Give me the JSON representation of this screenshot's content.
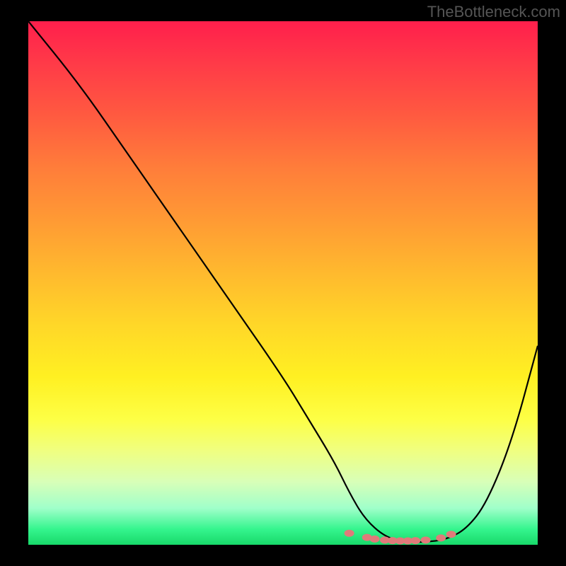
{
  "watermark": "TheBottleneck.com",
  "chart_data": {
    "type": "line",
    "title": "",
    "xlabel": "",
    "ylabel": "",
    "xlim": [
      0,
      100
    ],
    "ylim": [
      0,
      100
    ],
    "series": [
      {
        "name": "bottleneck-curve",
        "color": "#000000",
        "x": [
          0,
          10,
          20,
          30,
          40,
          50,
          55,
          60,
          63,
          66,
          70,
          74,
          78,
          82,
          86,
          90,
          95,
          100
        ],
        "y": [
          100,
          88,
          74,
          60,
          46,
          32,
          24,
          16,
          10,
          5,
          1.5,
          0.5,
          0.5,
          1,
          3,
          8,
          20,
          38
        ]
      }
    ],
    "markers": {
      "name": "highlight-dots",
      "color": "#e07a7a",
      "x": [
        63,
        66.5,
        68,
        70,
        71.5,
        73,
        74.5,
        76,
        78,
        81,
        83
      ],
      "y": [
        2.2,
        1.4,
        1.1,
        0.9,
        0.8,
        0.75,
        0.75,
        0.8,
        0.9,
        1.3,
        2.0
      ]
    },
    "gradient_meaning": "red=high bottleneck, green=low bottleneck"
  }
}
